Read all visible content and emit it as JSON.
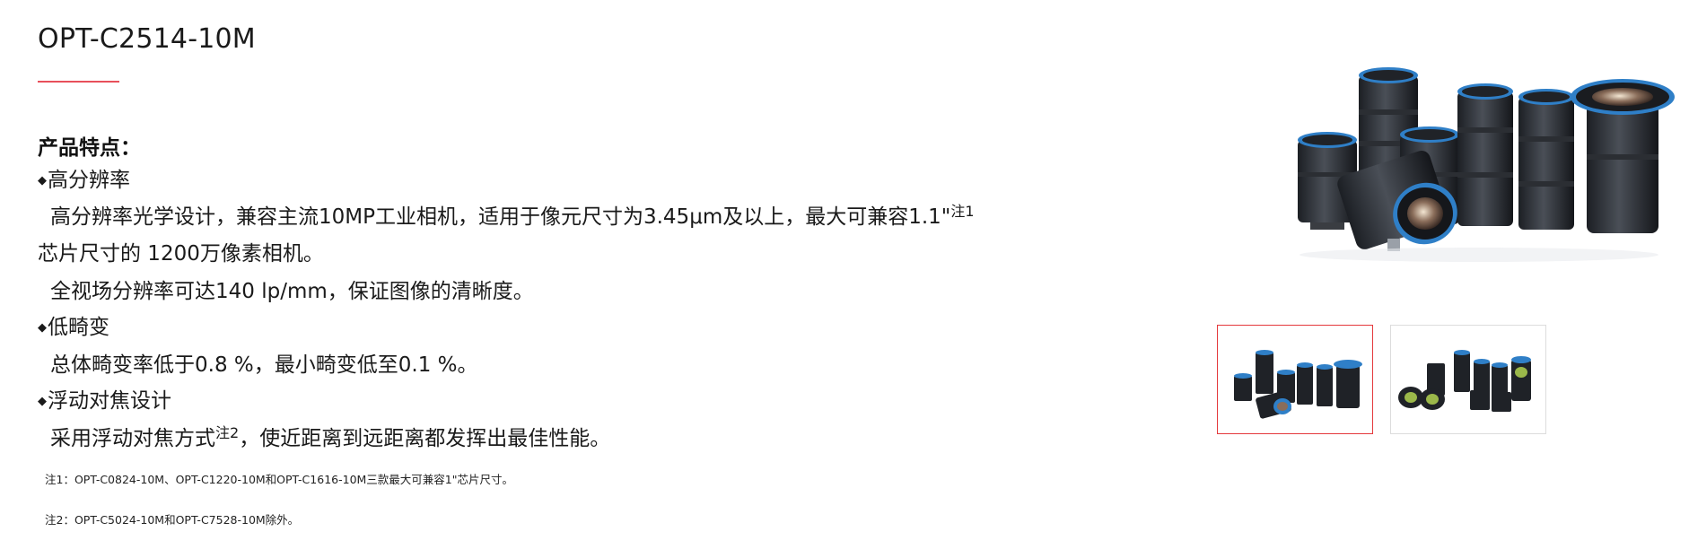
{
  "product": {
    "title": "OPT-C2514-10M"
  },
  "features": {
    "heading": "产品特点：",
    "bullet_glyph": "◆",
    "items": [
      {
        "title": "高分辨率",
        "para1_text": "高分辨率光学设计，兼容主流10MP工业相机，适用于像元尺寸为3.45μm及以上，最大可兼容1.1\"",
        "para1_sup": "注1",
        "para1_cont": "芯片尺寸的 1200万像素相机。",
        "para2_text": "全视场分辨率可达140 lp/mm，保证图像的清晰度。"
      },
      {
        "title": "低畸变",
        "para1_text": "总体畸变率低于0.8 %，最小畸变低至0.1 %。"
      },
      {
        "title": "浮动对焦设计",
        "para1_text": "采用浮动对焦方式",
        "para1_sup": "注2",
        "para1_cont": "，使近距离到远距离都发挥出最佳性能。"
      }
    ]
  },
  "notes": [
    "注1：OPT-C0824-10M、OPT-C1220-10M和OPT-C1616-10M三款最大可兼容1\"芯片尺寸。",
    "注2：OPT-C5024-10M和OPT-C7528-10M除外。"
  ],
  "gallery": {
    "selected_index": 0,
    "accent_color": "#e4393c",
    "lens_ring_color": "#2f7fc7",
    "thumbnails": [
      "lens-group-front-view",
      "lens-group-side-view"
    ]
  }
}
